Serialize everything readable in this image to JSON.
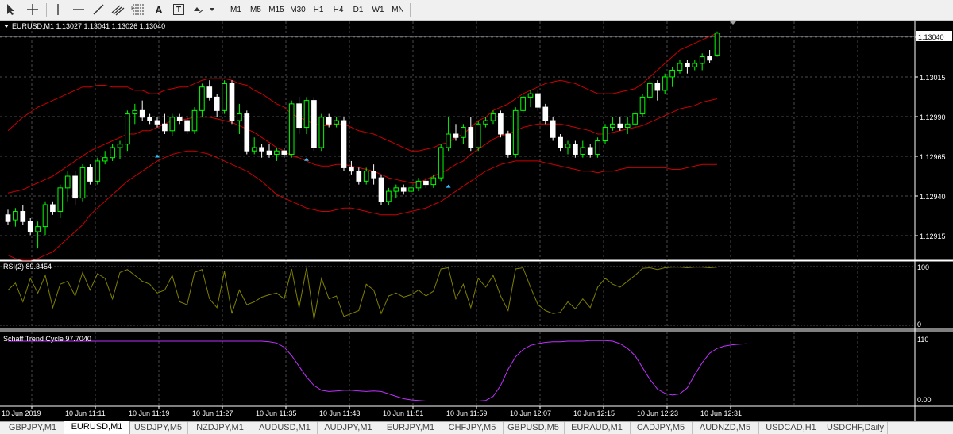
{
  "toolbar": {
    "tools": [
      {
        "name": "cursor-icon"
      },
      {
        "name": "crosshair-icon"
      },
      {
        "name": "vertical-line-icon"
      },
      {
        "name": "horizontal-line-icon"
      },
      {
        "name": "trendline-icon"
      },
      {
        "name": "equidistant-channel-icon"
      },
      {
        "name": "fibonacci-icon"
      },
      {
        "name": "text-icon",
        "label": "A"
      },
      {
        "name": "text-label-icon",
        "label": "T"
      },
      {
        "name": "shapes-dropdown-icon"
      }
    ],
    "timeframes": [
      "M1",
      "M5",
      "M15",
      "M30",
      "H1",
      "H4",
      "D1",
      "W1",
      "MN"
    ]
  },
  "chart": {
    "header": "EURUSD,M1  1.13027 1.13041 1.13026 1.13040",
    "price_labels": [
      "1.13040",
      "1.13015",
      "1.12990",
      "1.12965",
      "1.12940",
      "1.12915"
    ],
    "current_price": "1.13040",
    "time_labels": [
      "10 Jun 2019",
      "10 Jun 11:11",
      "10 Jun 11:19",
      "10 Jun 11:27",
      "10 Jun 11:35",
      "10 Jun 11:43",
      "10 Jun 11:51",
      "10 Jun 11:59",
      "10 Jun 12:07",
      "10 Jun 12:15",
      "10 Jun 12:23",
      "10 Jun 12:31"
    ],
    "rsi": {
      "label": "RSI(2) 89.3454",
      "scale_top": "100",
      "scale_bottom": "0"
    },
    "stc": {
      "label": "Schaff Trend Cycle 97.7040",
      "scale_top": "110",
      "scale_bottom": "0.00"
    },
    "colors": {
      "background": "#000000",
      "bull": "#00ff00",
      "bear": "#ffffff",
      "band": "#cc0000",
      "rsi": "#808000",
      "stc": "#c030ff",
      "grid": "#4a4a4a"
    }
  },
  "chart_data": {
    "type": "candlestick",
    "symbol": "EURUSD",
    "timeframe": "M1",
    "ylim": [
      1.12905,
      1.13047
    ],
    "candles": [
      [
        1.12932,
        1.12935,
        1.12926,
        1.12928
      ],
      [
        1.12929,
        1.12936,
        1.12925,
        1.12934
      ],
      [
        1.12934,
        1.12938,
        1.12926,
        1.12928
      ],
      [
        1.12928,
        1.1293,
        1.1292,
        1.12922
      ],
      [
        1.12922,
        1.12928,
        1.12912,
        1.12925
      ],
      [
        1.12925,
        1.1294,
        1.1292,
        1.12938
      ],
      [
        1.12938,
        1.1294,
        1.12932,
        1.12934
      ],
      [
        1.12934,
        1.1295,
        1.1293,
        1.12948
      ],
      [
        1.12948,
        1.12958,
        1.1294,
        1.12955
      ],
      [
        1.12955,
        1.12958,
        1.12938,
        1.12942
      ],
      [
        1.12942,
        1.12962,
        1.1294,
        1.1296
      ],
      [
        1.1296,
        1.12962,
        1.1295,
        1.12952
      ],
      [
        1.12952,
        1.12966,
        1.1295,
        1.12964
      ],
      [
        1.12964,
        1.1297,
        1.12962,
        1.12966
      ],
      [
        1.12966,
        1.12974,
        1.12964,
        1.12972
      ],
      [
        1.12972,
        1.12976,
        1.12965,
        1.12974
      ],
      [
        1.12974,
        1.12994,
        1.1297,
        1.12992
      ],
      [
        1.12992,
        1.12998,
        1.12986,
        1.12994
      ],
      [
        1.12994,
        1.13,
        1.12988,
        1.1299
      ],
      [
        1.1299,
        1.12992,
        1.12986,
        1.12988
      ],
      [
        1.12988,
        1.1299,
        1.12984,
        1.12986
      ],
      [
        1.12986,
        1.12992,
        1.1298,
        1.12982
      ],
      [
        1.12982,
        1.12992,
        1.12979,
        1.1299
      ],
      [
        1.1299,
        1.12992,
        1.12986,
        1.12988
      ],
      [
        1.12988,
        1.1299,
        1.1298,
        1.12982
      ],
      [
        1.12982,
        1.12996,
        1.1298,
        1.12994
      ],
      [
        1.12994,
        1.1301,
        1.1299,
        1.13008
      ],
      [
        1.13008,
        1.13012,
        1.13,
        1.13002
      ],
      [
        1.13002,
        1.13004,
        1.1299,
        1.12994
      ],
      [
        1.12994,
        1.13012,
        1.12992,
        1.1301
      ],
      [
        1.1301,
        1.13012,
        1.12986,
        1.12988
      ],
      [
        1.12988,
        1.12998,
        1.1298,
        1.12992
      ],
      [
        1.12992,
        1.12994,
        1.12968,
        1.1297
      ],
      [
        1.1297,
        1.12978,
        1.12968,
        1.12972
      ],
      [
        1.12972,
        1.12974,
        1.12966,
        1.1297
      ],
      [
        1.1297,
        1.12974,
        1.12966,
        1.12968
      ],
      [
        1.12968,
        1.12972,
        1.12964,
        1.1297
      ],
      [
        1.1297,
        1.12972,
        1.12966,
        1.12968
      ],
      [
        1.12968,
        1.13,
        1.12966,
        1.12998
      ],
      [
        1.12998,
        1.13002,
        1.1298,
        1.12984
      ],
      [
        1.12984,
        1.13002,
        1.1298,
        1.13
      ],
      [
        1.13,
        1.13002,
        1.1297,
        1.12972
      ],
      [
        1.12972,
        1.12992,
        1.1297,
        1.1299
      ],
      [
        1.1299,
        1.12992,
        1.12984,
        1.12986
      ],
      [
        1.12986,
        1.1299,
        1.12984,
        1.12988
      ],
      [
        1.12988,
        1.1299,
        1.12958,
        1.1296
      ],
      [
        1.1296,
        1.12964,
        1.12956,
        1.12958
      ],
      [
        1.12958,
        1.1296,
        1.1295,
        1.12952
      ],
      [
        1.12952,
        1.1296,
        1.1295,
        1.12958
      ],
      [
        1.12958,
        1.12962,
        1.1295,
        1.12954
      ],
      [
        1.12954,
        1.12956,
        1.12938,
        1.1294
      ],
      [
        1.1294,
        1.12948,
        1.12938,
        1.12946
      ],
      [
        1.12946,
        1.1295,
        1.12942,
        1.12948
      ],
      [
        1.12948,
        1.1295,
        1.12944,
        1.12946
      ],
      [
        1.12946,
        1.1295,
        1.12944,
        1.12948
      ],
      [
        1.12948,
        1.12954,
        1.12946,
        1.12952
      ],
      [
        1.12952,
        1.12954,
        1.12948,
        1.1295
      ],
      [
        1.1295,
        1.12956,
        1.12948,
        1.12954
      ],
      [
        1.12954,
        1.12974,
        1.12952,
        1.12972
      ],
      [
        1.12972,
        1.1299,
        1.1297,
        1.1298
      ],
      [
        1.1298,
        1.12986,
        1.12976,
        1.12978
      ],
      [
        1.12978,
        1.12986,
        1.12974,
        1.12984
      ],
      [
        1.12984,
        1.1299,
        1.1297,
        1.12972
      ],
      [
        1.12972,
        1.12988,
        1.1297,
        1.12986
      ],
      [
        1.12986,
        1.1299,
        1.12984,
        1.12988
      ],
      [
        1.12988,
        1.12994,
        1.12986,
        1.12992
      ],
      [
        1.12992,
        1.12994,
        1.12978,
        1.1298
      ],
      [
        1.1298,
        1.12982,
        1.12966,
        1.12968
      ],
      [
        1.12968,
        1.12996,
        1.12966,
        1.12994
      ],
      [
        1.12994,
        1.13004,
        1.12992,
        1.13002
      ],
      [
        1.13002,
        1.13006,
        1.12996,
        1.13004
      ],
      [
        1.13004,
        1.13006,
        1.12994,
        1.12996
      ],
      [
        1.12996,
        1.12998,
        1.12986,
        1.12988
      ],
      [
        1.12988,
        1.1299,
        1.12976,
        1.12978
      ],
      [
        1.12978,
        1.1298,
        1.1297,
        1.12972
      ],
      [
        1.12972,
        1.12976,
        1.12968,
        1.12974
      ],
      [
        1.12974,
        1.12976,
        1.12966,
        1.12968
      ],
      [
        1.12968,
        1.12976,
        1.12966,
        1.12972
      ],
      [
        1.12972,
        1.12974,
        1.12966,
        1.12968
      ],
      [
        1.12968,
        1.12978,
        1.12966,
        1.12976
      ],
      [
        1.12976,
        1.12986,
        1.12974,
        1.12984
      ],
      [
        1.12984,
        1.1299,
        1.12982,
        1.12986
      ],
      [
        1.12986,
        1.1299,
        1.12982,
        1.12984
      ],
      [
        1.12984,
        1.1299,
        1.1298,
        1.12986
      ],
      [
        1.12986,
        1.12994,
        1.12984,
        1.12992
      ],
      [
        1.12992,
        1.13004,
        1.1299,
        1.13002
      ],
      [
        1.13002,
        1.13012,
        1.13,
        1.1301
      ],
      [
        1.1301,
        1.13012,
        1.13,
        1.13006
      ],
      [
        1.13006,
        1.13016,
        1.13004,
        1.13014
      ],
      [
        1.13014,
        1.1302,
        1.13008,
        1.13018
      ],
      [
        1.13018,
        1.13024,
        1.13016,
        1.13022
      ],
      [
        1.13022,
        1.13024,
        1.13016,
        1.1302
      ],
      [
        1.1302,
        1.13024,
        1.13018,
        1.13022
      ],
      [
        1.13022,
        1.13028,
        1.13018,
        1.13026
      ],
      [
        1.13026,
        1.1303,
        1.13022,
        1.13024
      ],
      [
        1.13027,
        1.13041,
        1.13026,
        1.1304
      ]
    ],
    "rsi": [
      60,
      72,
      40,
      80,
      55,
      85,
      30,
      70,
      75,
      50,
      90,
      60,
      88,
      80,
      45,
      90,
      95,
      85,
      75,
      70,
      55,
      60,
      85,
      40,
      35,
      90,
      95,
      45,
      30,
      92,
      20,
      60,
      35,
      40,
      48,
      52,
      55,
      45,
      96,
      30,
      98,
      10,
      80,
      45,
      50,
      15,
      20,
      25,
      70,
      60,
      20,
      50,
      55,
      48,
      52,
      60,
      50,
      58,
      96,
      98,
      45,
      70,
      30,
      80,
      65,
      85,
      50,
      25,
      96,
      98,
      65,
      35,
      25,
      20,
      22,
      40,
      28,
      45,
      30,
      65,
      80,
      70,
      65,
      75,
      85,
      97,
      98,
      95,
      98,
      99,
      99,
      98,
      99,
      99,
      98,
      99
    ],
    "stc": [
      102,
      102,
      102,
      102,
      102,
      102,
      102,
      102,
      102,
      102,
      102,
      102,
      102,
      102,
      102,
      102,
      102,
      102,
      102,
      102,
      102,
      102,
      102,
      102,
      102,
      102,
      102,
      102,
      102,
      102,
      102,
      102,
      102,
      102,
      102,
      101,
      99,
      92,
      78,
      60,
      42,
      28,
      20,
      18,
      19,
      20,
      20,
      19,
      18,
      19,
      18,
      14,
      10,
      6,
      4,
      3,
      2,
      2,
      2,
      2,
      2,
      2,
      2,
      2,
      3,
      10,
      28,
      55,
      76,
      88,
      95,
      98,
      100,
      101,
      101,
      102,
      102,
      102,
      103,
      103,
      103,
      102,
      98,
      90,
      78,
      58,
      38,
      22,
      15,
      12,
      14,
      24,
      46,
      66,
      82,
      90,
      94,
      96,
      97,
      97.7
    ],
    "bands_upper": [
      1.12982,
      1.12986,
      1.1299,
      1.12993,
      1.12996,
      1.12998,
      1.13,
      1.13002,
      1.13004,
      1.13006,
      1.13008,
      1.13008,
      1.13009,
      1.13009,
      1.13008,
      1.13008,
      1.13008,
      1.13006,
      1.13006,
      1.13004,
      1.13004,
      1.13006,
      1.13007,
      1.13008,
      1.13008,
      1.1301,
      1.13012,
      1.13013,
      1.13013,
      1.13013,
      1.13012,
      1.1301,
      1.13009,
      1.13006,
      1.13004,
      1.13001,
      1.12998,
      1.12996,
      1.12992,
      1.1299,
      1.12988,
      1.12986,
      1.12985,
      1.12985,
      1.12986,
      1.12986,
      1.12984,
      1.12982,
      1.12981,
      1.1298,
      1.12978,
      1.12976,
      1.12974,
      1.12972,
      1.1297,
      1.1297,
      1.12971,
      1.12972,
      1.12974,
      1.12975,
      1.12978,
      1.1298,
      1.12984,
      1.12988,
      1.1299,
      1.12994,
      1.12996,
      1.12998,
      1.13001,
      1.13004,
      1.13006,
      1.13008,
      1.1301,
      1.13011,
      1.13012,
      1.13011,
      1.1301,
      1.13008,
      1.13006,
      1.13004,
      1.13004,
      1.13004,
      1.13005,
      1.13006,
      1.13007,
      1.1301,
      1.13014,
      1.13018,
      1.13022,
      1.13026,
      1.1303,
      1.13032,
      1.13034,
      1.13036,
      1.13038,
      1.1304
    ],
    "bands_lower": [
      1.12908,
      1.12906,
      1.12905,
      1.12905,
      1.12906,
      1.12908,
      1.1291,
      1.12914,
      1.12918,
      1.12922,
      1.12926,
      1.12932,
      1.12936,
      1.1294,
      1.12944,
      1.12948,
      1.12952,
      1.12955,
      1.12958,
      1.12961,
      1.12964,
      1.12966,
      1.12968,
      1.12969,
      1.1297,
      1.1297,
      1.12969,
      1.12968,
      1.12966,
      1.12964,
      1.12962,
      1.1296,
      1.12958,
      1.12955,
      1.12952,
      1.12948,
      1.12944,
      1.12942,
      1.1294,
      1.12938,
      1.12936,
      1.12935,
      1.12934,
      1.12934,
      1.12935,
      1.12936,
      1.12936,
      1.12935,
      1.12934,
      1.12933,
      1.12932,
      1.12932,
      1.12932,
      1.12933,
      1.12934,
      1.12935,
      1.12936,
      1.12938,
      1.1294,
      1.12943,
      1.12946,
      1.12949,
      1.12952,
      1.12955,
      1.12958,
      1.1296,
      1.12962,
      1.12963,
      1.12964,
      1.12964,
      1.12964,
      1.12964,
      1.12963,
      1.12962,
      1.12961,
      1.1296,
      1.12959,
      1.12958,
      1.12958,
      1.12957,
      1.12958,
      1.12958,
      1.12959,
      1.1296,
      1.1296,
      1.1296,
      1.1296,
      1.1296,
      1.1296,
      1.12959,
      1.12959,
      1.1296,
      1.12961,
      1.12962,
      1.12962,
      1.12962
    ],
    "bands_mid": [
      1.12945,
      1.12946,
      1.12947,
      1.12949,
      1.12951,
      1.12953,
      1.12955,
      1.12958,
      1.12961,
      1.12964,
      1.12967,
      1.1297,
      1.12972,
      1.12974,
      1.12976,
      1.12978,
      1.1298,
      1.1298,
      1.12982,
      1.12982,
      1.12984,
      1.12986,
      1.12988,
      1.12988,
      1.12989,
      1.1299,
      1.1299,
      1.1299,
      1.12989,
      1.12988,
      1.12987,
      1.12985,
      1.12983,
      1.12981,
      1.12978,
      1.12975,
      1.12972,
      1.1297,
      1.12967,
      1.12966,
      1.12964,
      1.12962,
      1.12961,
      1.12961,
      1.12962,
      1.12962,
      1.12961,
      1.1296,
      1.12959,
      1.12958,
      1.12956,
      1.12954,
      1.12953,
      1.12952,
      1.12951,
      1.12951,
      1.12953,
      1.12955,
      1.12957,
      1.12959,
      1.12962,
      1.12964,
      1.12968,
      1.12971,
      1.12974,
      1.12977,
      1.12979,
      1.1298,
      1.12982,
      1.12984,
      1.12985,
      1.12986,
      1.12986,
      1.12986,
      1.12986,
      1.12985,
      1.12984,
      1.12983,
      1.12982,
      1.1298,
      1.1298,
      1.12981,
      1.12982,
      1.12983,
      1.12984,
      1.12985,
      1.12987,
      1.12989,
      1.12991,
      1.12993,
      1.12995,
      1.12996,
      1.12997,
      1.12999,
      1.13,
      1.13001
    ]
  },
  "tabs": [
    {
      "label": "GBPJPY,M1",
      "active": false
    },
    {
      "label": "EURUSD,M1",
      "active": true
    },
    {
      "label": "USDJPY,M5",
      "active": false
    },
    {
      "label": "NZDJPY,M1",
      "active": false
    },
    {
      "label": "AUDUSD,M1",
      "active": false
    },
    {
      "label": "AUDJPY,M1",
      "active": false
    },
    {
      "label": "EURJPY,M1",
      "active": false
    },
    {
      "label": "CHFJPY,M5",
      "active": false
    },
    {
      "label": "GBPUSD,M5",
      "active": false
    },
    {
      "label": "EURAUD,M1",
      "active": false
    },
    {
      "label": "CADJPY,M5",
      "active": false
    },
    {
      "label": "AUDNZD,M5",
      "active": false
    },
    {
      "label": "USDCAD,H1",
      "active": false
    },
    {
      "label": "USDCHF,Daily",
      "active": false
    }
  ]
}
